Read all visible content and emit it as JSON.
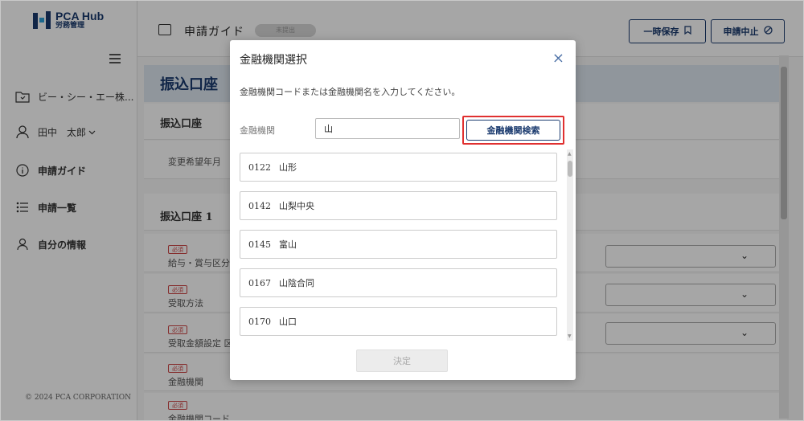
{
  "sidebar": {
    "logo_title": "PCA Hub",
    "logo_sub": "労務管理",
    "company": "ビー・シー・エー株...",
    "user": "田中　太郎",
    "items": [
      {
        "label": "申請ガイド",
        "icon": "info-circle-icon"
      },
      {
        "label": "申請一覧",
        "icon": "list-icon"
      },
      {
        "label": "自分の情報",
        "icon": "person-icon"
      }
    ],
    "copyright": "© 2024 PCA CORPORATION"
  },
  "topbar": {
    "title": "申請ガイド",
    "status": "未提出",
    "save_label": "一時保存",
    "cancel_label": "申請中止"
  },
  "main": {
    "section_title": "振込口座",
    "card1_title": "振込口座",
    "card1_row": "変更希望年月",
    "card2_title": "振込口座 1",
    "required_badge": "必須",
    "rows": [
      "給与・賞与区分",
      "受取方法",
      "受取金額設定 区",
      "金融機関",
      "金融機関コード"
    ]
  },
  "modal": {
    "title": "金融機関選択",
    "close": "×",
    "instruction": "金融機関コードまたは金融機関名を入力してください。",
    "field_label": "金融機関",
    "input_value": "山",
    "search_label": "金融機関検索",
    "results": [
      {
        "code": "0122",
        "name": "山形"
      },
      {
        "code": "0142",
        "name": "山梨中央"
      },
      {
        "code": "0145",
        "name": "富山"
      },
      {
        "code": "0167",
        "name": "山陰合同"
      },
      {
        "code": "0170",
        "name": "山口"
      }
    ],
    "confirm_label": "決定"
  }
}
